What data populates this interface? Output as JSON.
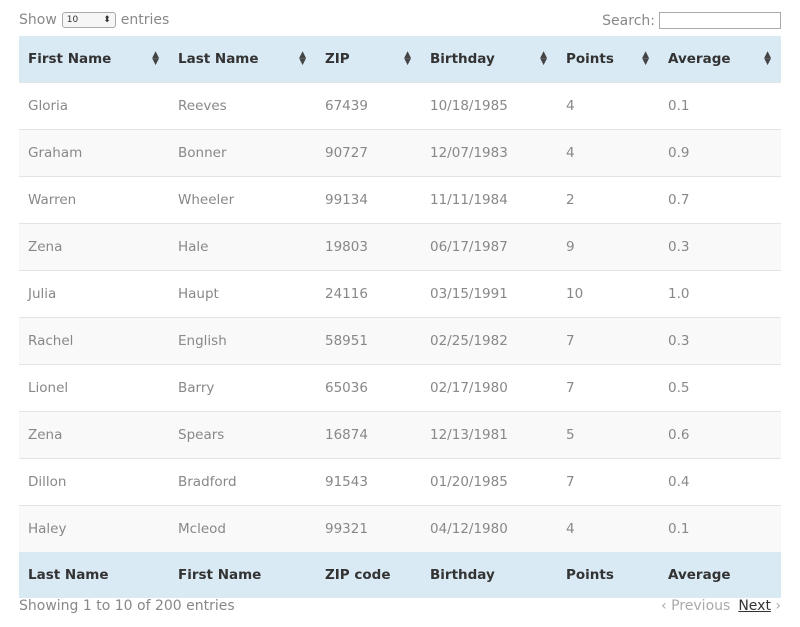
{
  "controls": {
    "show_label": "Show",
    "entries_label": "entries",
    "length_value": "10",
    "search_label": "Search:",
    "search_value": ""
  },
  "table": {
    "headers": [
      "First Name",
      "Last Name",
      "ZIP",
      "Birthday",
      "Points",
      "Average"
    ],
    "rows": [
      [
        "Gloria",
        "Reeves",
        "67439",
        "10/18/1985",
        "4",
        "0.1"
      ],
      [
        "Graham",
        "Bonner",
        "90727",
        "12/07/1983",
        "4",
        "0.9"
      ],
      [
        "Warren",
        "Wheeler",
        "99134",
        "11/11/1984",
        "2",
        "0.7"
      ],
      [
        "Zena",
        "Hale",
        "19803",
        "06/17/1987",
        "9",
        "0.3"
      ],
      [
        "Julia",
        "Haupt",
        "24116",
        "03/15/1991",
        "10",
        "1.0"
      ],
      [
        "Rachel",
        "English",
        "58951",
        "02/25/1982",
        "7",
        "0.3"
      ],
      [
        "Lionel",
        "Barry",
        "65036",
        "02/17/1980",
        "7",
        "0.5"
      ],
      [
        "Zena",
        "Spears",
        "16874",
        "12/13/1981",
        "5",
        "0.6"
      ],
      [
        "Dillon",
        "Bradford",
        "91543",
        "01/20/1985",
        "7",
        "0.4"
      ],
      [
        "Haley",
        "Mcleod",
        "99321",
        "04/12/1980",
        "4",
        "0.1"
      ]
    ],
    "footers": [
      "Last Name",
      "First Name",
      "ZIP code",
      "Birthday",
      "Points",
      "Average"
    ]
  },
  "footer": {
    "info": "Showing 1 to 10 of 200 entries",
    "previous": "Previous",
    "next": "Next"
  }
}
